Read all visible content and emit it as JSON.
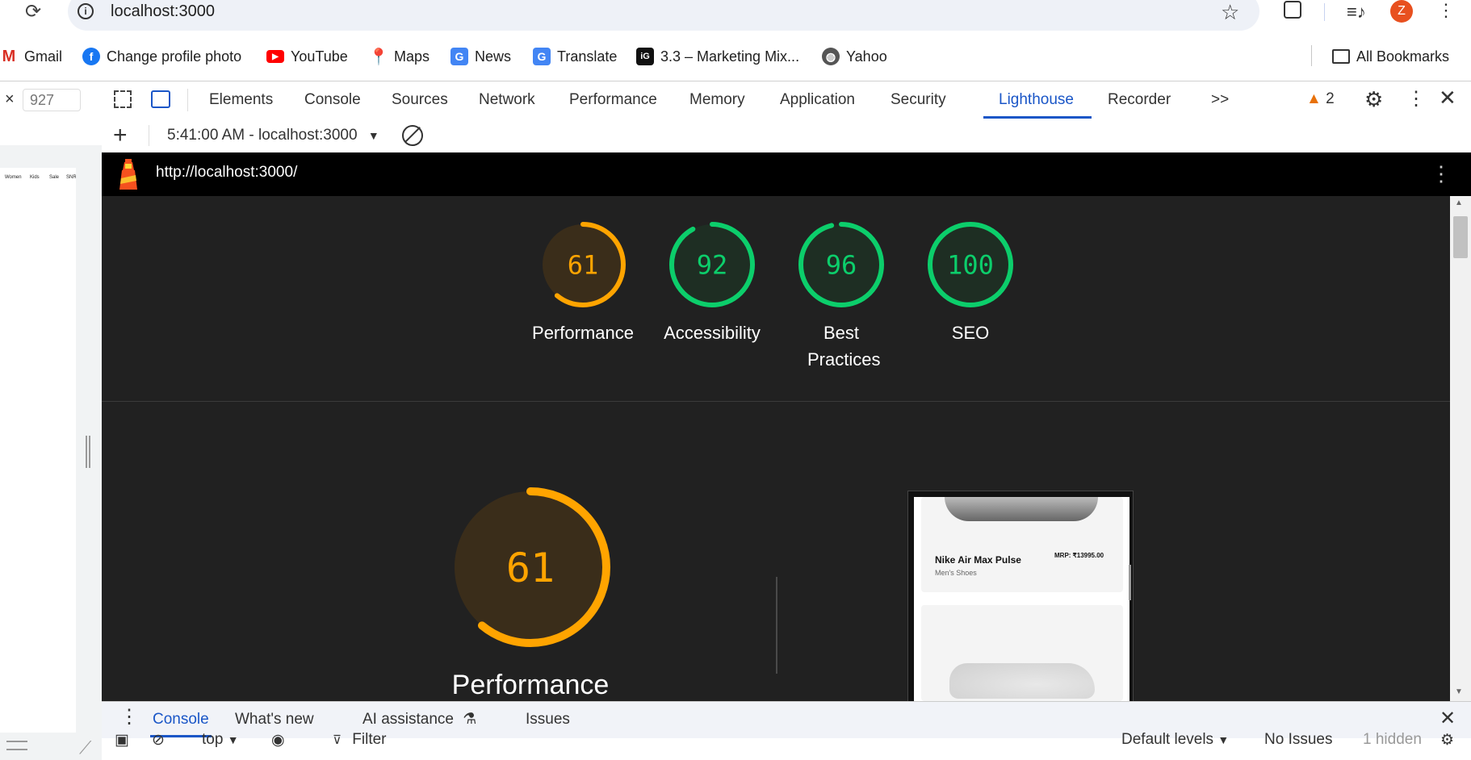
{
  "browser": {
    "url": "localhost:3000",
    "avatar_letter": "Z"
  },
  "bookmarks": [
    {
      "label": "Gmail",
      "color": "#d93025",
      "glyph": "M"
    },
    {
      "label": "Change profile photo",
      "color": "#1877f2",
      "glyph": "f"
    },
    {
      "label": "YouTube",
      "color": "#ff0000",
      "glyph": "▶"
    },
    {
      "label": "Maps",
      "color": "#34a853",
      "glyph": "◉"
    },
    {
      "label": "News",
      "color": "#4285f4",
      "glyph": "G"
    },
    {
      "label": "Translate",
      "color": "#4285f4",
      "glyph": "G"
    },
    {
      "label": "3.3 – Marketing Mix...",
      "color": "#111111",
      "glyph": "iG"
    },
    {
      "label": "Yahoo",
      "color": "#555555",
      "glyph": "◍"
    }
  ],
  "all_bookmarks": "All Bookmarks",
  "devtools": {
    "width_value": "927",
    "tabs": [
      "Elements",
      "Console",
      "Sources",
      "Network",
      "Performance",
      "Memory",
      "Application",
      "Security",
      "Lighthouse",
      "Recorder"
    ],
    "active_tab": "Lighthouse",
    "more_tabs": ">>",
    "warning_count": "2",
    "report_selector": "5:41:00 AM - localhost:3000",
    "mini_nav": [
      "Women",
      "Kids",
      "Sale",
      "SNR"
    ]
  },
  "lighthouse": {
    "url": "http://localhost:3000/",
    "scores": [
      {
        "label": "Performance",
        "score": 61,
        "color": "#ffa400",
        "bg": "#3a2d1a"
      },
      {
        "label": "Accessibility",
        "score": 92,
        "color": "#0cce6b",
        "bg": "#1e2e23"
      },
      {
        "label": "Best Practices",
        "score": 96,
        "color": "#0cce6b",
        "bg": "#1e2e23"
      },
      {
        "label": "SEO",
        "score": 100,
        "color": "#0cce6b",
        "bg": "#1e2e23"
      }
    ],
    "big_gauge": {
      "label": "Performance",
      "score": 61,
      "color": "#ffa400"
    },
    "thumbnail": {
      "product_name": "Nike Air Max Pulse",
      "product_sub": "Men's Shoes",
      "price": "MRP: ₹13995.00"
    }
  },
  "drawer": {
    "tabs": [
      "Console",
      "What's new",
      "AI assistance",
      "Issues"
    ],
    "active_tab": "Console",
    "context": "top",
    "filter_placeholder": "Filter",
    "levels": "Default levels",
    "issues": "No Issues",
    "hidden": "1 hidden"
  }
}
